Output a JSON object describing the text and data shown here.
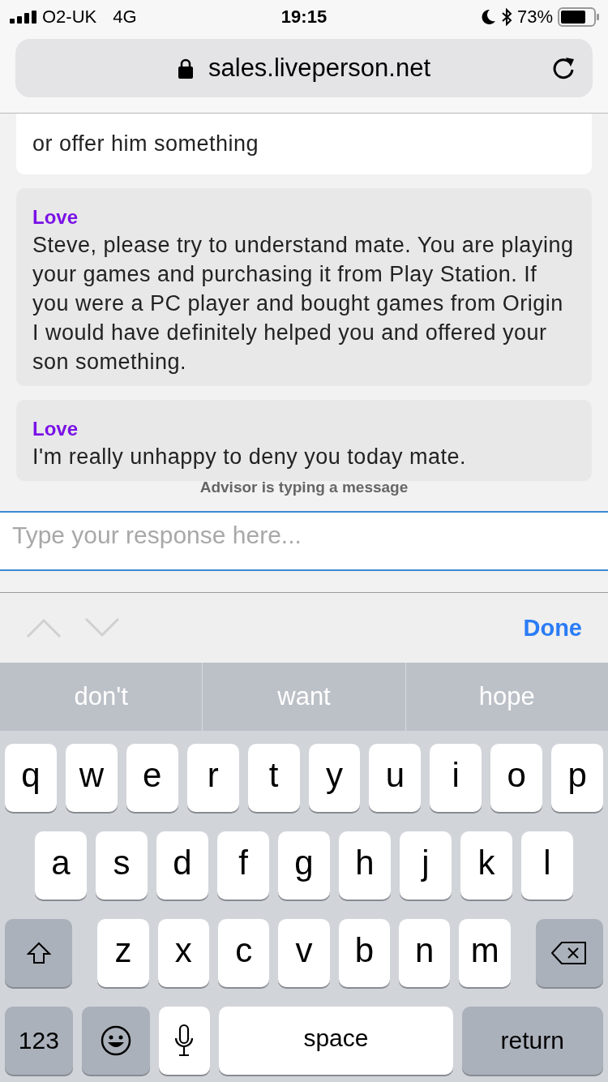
{
  "status_bar": {
    "carrier": "O2-UK",
    "network": "4G",
    "time": "19:15",
    "battery": "73%",
    "do_not_disturb": true,
    "bluetooth": true
  },
  "url_bar": {
    "url": "sales.liveperson.net",
    "secure": true
  },
  "messages": [
    {
      "kind": "visitor",
      "text": "or offer him something"
    },
    {
      "kind": "agent",
      "sender": "Love",
      "text": "Steve, please try to understand mate. You are playing your games and purchasing it from Play Station. If you were a PC player and bought games from Origin I would have definitely helped you and offered your son something."
    },
    {
      "kind": "agent",
      "sender": "Love",
      "text": "I'm really unhappy to deny you today mate."
    }
  ],
  "typing_indicator": "Advisor is typing a message",
  "input": {
    "placeholder": "Type your response here..."
  },
  "accessory_bar": {
    "previous_disabled": true,
    "next_disabled": true,
    "done": "Done"
  },
  "suggestions": [
    "don't",
    "want",
    "hope"
  ],
  "keyboard": [
    [
      {
        "kind": "letter",
        "label": "q"
      },
      {
        "kind": "letter",
        "label": "w"
      },
      {
        "kind": "letter",
        "label": "e"
      },
      {
        "kind": "letter",
        "label": "r"
      },
      {
        "kind": "letter",
        "label": "t"
      },
      {
        "kind": "letter",
        "label": "y"
      },
      {
        "kind": "letter",
        "label": "u"
      },
      {
        "kind": "letter",
        "label": "i"
      },
      {
        "kind": "letter",
        "label": "o"
      },
      {
        "kind": "letter",
        "label": "p"
      }
    ],
    [
      {
        "kind": "letter",
        "label": "a"
      },
      {
        "kind": "letter",
        "label": "s"
      },
      {
        "kind": "letter",
        "label": "d"
      },
      {
        "kind": "letter",
        "label": "f"
      },
      {
        "kind": "letter",
        "label": "g"
      },
      {
        "kind": "letter",
        "label": "h"
      },
      {
        "kind": "letter",
        "label": "j"
      },
      {
        "kind": "letter",
        "label": "k"
      },
      {
        "kind": "letter",
        "label": "l"
      }
    ],
    [
      {
        "kind": "shift"
      },
      {
        "kind": "letter",
        "label": "z"
      },
      {
        "kind": "letter",
        "label": "x"
      },
      {
        "kind": "letter",
        "label": "c"
      },
      {
        "kind": "letter",
        "label": "v"
      },
      {
        "kind": "letter",
        "label": "b"
      },
      {
        "kind": "letter",
        "label": "n"
      },
      {
        "kind": "letter",
        "label": "m"
      },
      {
        "kind": "delete"
      }
    ],
    [
      {
        "kind": "numbers",
        "label": "123"
      },
      {
        "kind": "emoji"
      },
      {
        "kind": "mic"
      },
      {
        "kind": "space",
        "label": "space"
      },
      {
        "kind": "return",
        "label": "return"
      }
    ]
  ]
}
